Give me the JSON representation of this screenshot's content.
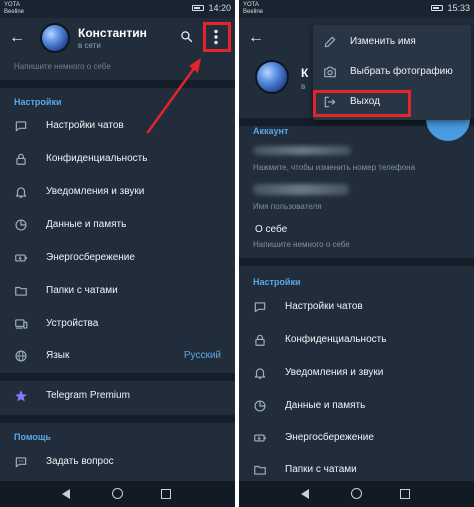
{
  "status_bar": {
    "carrier_line1": "YOTA",
    "carrier_line2": "Beeline",
    "left_time": "14:20",
    "right_time": "15:33"
  },
  "profile": {
    "name": "Константин",
    "status": "в сети",
    "bio_placeholder": "Напишите немного о себе"
  },
  "left_settings": {
    "title": "Настройки",
    "items": [
      {
        "icon": "chat-bubble-icon",
        "label": "Настройки чатов"
      },
      {
        "icon": "lock-icon",
        "label": "Конфиденциальность"
      },
      {
        "icon": "bell-icon",
        "label": "Уведомления и звуки"
      },
      {
        "icon": "pie-chart-icon",
        "label": "Данные и память"
      },
      {
        "icon": "battery-icon",
        "label": "Энергосбережение"
      },
      {
        "icon": "folder-icon",
        "label": "Папки с чатами"
      },
      {
        "icon": "devices-icon",
        "label": "Устройства"
      },
      {
        "icon": "globe-icon",
        "label": "Язык",
        "value": "Русский"
      }
    ]
  },
  "premium": {
    "icon": "star-icon",
    "label": "Telegram Premium"
  },
  "help": {
    "title": "Помощь",
    "items": [
      {
        "icon": "chat-question-icon",
        "label": "Задать вопрос"
      }
    ]
  },
  "menu": {
    "items": [
      {
        "icon": "pencil-icon",
        "label": "Изменить имя"
      },
      {
        "icon": "camera-icon",
        "label": "Выбрать фотографию"
      },
      {
        "icon": "logout-icon",
        "label": "Выход"
      }
    ]
  },
  "account": {
    "title": "Аккаунт",
    "phone_hint": "Нажмите, чтобы изменить номер телефона",
    "username_hint": "Имя пользователя",
    "about_label": "О себе",
    "about_hint": "Напишите немного о себе"
  },
  "right_settings": {
    "title": "Настройки",
    "items": [
      {
        "icon": "chat-bubble-icon",
        "label": "Настройки чатов"
      },
      {
        "icon": "lock-icon",
        "label": "Конфиденциальность"
      },
      {
        "icon": "bell-icon",
        "label": "Уведомления и звуки"
      },
      {
        "icon": "pie-chart-icon",
        "label": "Данные и память"
      },
      {
        "icon": "battery-icon",
        "label": "Энергосбережение"
      },
      {
        "icon": "folder-icon",
        "label": "Папки с чатами"
      }
    ]
  },
  "colors": {
    "background": "#212d3b",
    "accent": "#5aa7e8",
    "highlight": "#e3242b"
  }
}
